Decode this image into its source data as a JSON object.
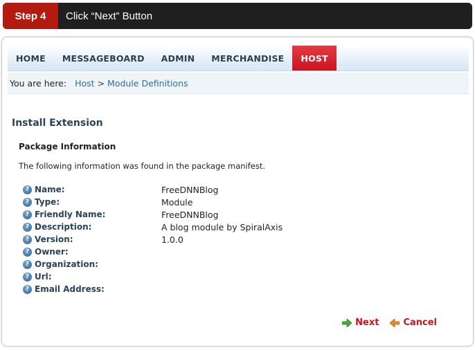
{
  "step": {
    "badge": "Step 4",
    "text": "Click “Next” Button"
  },
  "nav": {
    "items": [
      {
        "label": "HOME"
      },
      {
        "label": "MESSAGEBOARD"
      },
      {
        "label": "ADMIN"
      },
      {
        "label": "MERCHANDISE"
      },
      {
        "label": "HOST",
        "active": true
      }
    ]
  },
  "breadcrumb": {
    "lead": "You are here:",
    "root": "Host",
    "separator": ">",
    "current": "Module Definitions"
  },
  "page": {
    "title": "Install Extension",
    "section": "Package Information",
    "description": "The following information was found in the package manifest."
  },
  "package": [
    {
      "label": "Name:",
      "value": "FreeDNNBlog"
    },
    {
      "label": "Type:",
      "value": "Module"
    },
    {
      "label": "Friendly Name:",
      "value": "FreeDNNBlog"
    },
    {
      "label": "Description:",
      "value": "A blog module by SpiralAxis"
    },
    {
      "label": "Version:",
      "value": "1.0.0"
    },
    {
      "label": "Owner:",
      "value": ""
    },
    {
      "label": "Organization:",
      "value": ""
    },
    {
      "label": "Url:",
      "value": ""
    },
    {
      "label": "Email Address:",
      "value": ""
    }
  ],
  "actions": {
    "next": "Next",
    "cancel": "Cancel"
  },
  "colors": {
    "step_badge": "#b31b10",
    "nav_active": "#c9141f",
    "link": "#2f6f9f",
    "action": "#c8141c"
  }
}
